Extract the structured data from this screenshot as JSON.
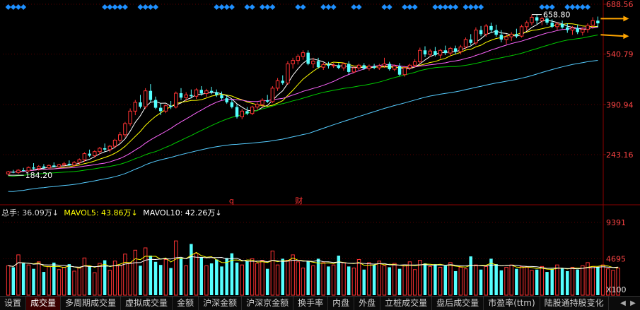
{
  "chart_data": {
    "type": "candlestick",
    "price_axis": {
      "ticks": [
        "688.56",
        "540.79",
        "390.94",
        "243.16"
      ],
      "ylim": [
        105,
        688.56
      ]
    },
    "annotations": {
      "high_label": "658.80",
      "low_label": "184.20",
      "event_markers": [
        "q",
        "财"
      ]
    },
    "candles": [
      {
        "o": 186,
        "h": 195,
        "l": 182,
        "c": 192
      },
      {
        "o": 192,
        "h": 198,
        "l": 188,
        "c": 190
      },
      {
        "o": 190,
        "h": 200,
        "l": 186,
        "c": 197
      },
      {
        "o": 197,
        "h": 204,
        "l": 193,
        "c": 195
      },
      {
        "o": 195,
        "h": 208,
        "l": 192,
        "c": 205
      },
      {
        "o": 205,
        "h": 218,
        "l": 198,
        "c": 202
      },
      {
        "o": 202,
        "h": 212,
        "l": 196,
        "c": 208
      },
      {
        "o": 208,
        "h": 215,
        "l": 200,
        "c": 204
      },
      {
        "o": 204,
        "h": 214,
        "l": 200,
        "c": 211
      },
      {
        "o": 211,
        "h": 220,
        "l": 205,
        "c": 207
      },
      {
        "o": 207,
        "h": 216,
        "l": 203,
        "c": 213
      },
      {
        "o": 213,
        "h": 222,
        "l": 208,
        "c": 216
      },
      {
        "o": 216,
        "h": 226,
        "l": 210,
        "c": 212
      },
      {
        "o": 212,
        "h": 224,
        "l": 208,
        "c": 220
      },
      {
        "o": 220,
        "h": 232,
        "l": 214,
        "c": 228
      },
      {
        "o": 228,
        "h": 250,
        "l": 222,
        "c": 246
      },
      {
        "o": 246,
        "h": 258,
        "l": 236,
        "c": 240
      },
      {
        "o": 240,
        "h": 256,
        "l": 234,
        "c": 252
      },
      {
        "o": 252,
        "h": 266,
        "l": 244,
        "c": 262
      },
      {
        "o": 262,
        "h": 276,
        "l": 252,
        "c": 258
      },
      {
        "o": 258,
        "h": 272,
        "l": 250,
        "c": 268
      },
      {
        "o": 268,
        "h": 290,
        "l": 262,
        "c": 286
      },
      {
        "o": 286,
        "h": 310,
        "l": 278,
        "c": 302
      },
      {
        "o": 302,
        "h": 340,
        "l": 294,
        "c": 335
      },
      {
        "o": 335,
        "h": 380,
        "l": 328,
        "c": 372
      },
      {
        "o": 372,
        "h": 405,
        "l": 360,
        "c": 398
      },
      {
        "o": 398,
        "h": 420,
        "l": 380,
        "c": 385
      },
      {
        "o": 385,
        "h": 440,
        "l": 378,
        "c": 432
      },
      {
        "o": 432,
        "h": 452,
        "l": 398,
        "c": 405
      },
      {
        "o": 405,
        "h": 415,
        "l": 378,
        "c": 382
      },
      {
        "o": 382,
        "h": 395,
        "l": 360,
        "c": 372
      },
      {
        "o": 372,
        "h": 392,
        "l": 366,
        "c": 388
      },
      {
        "o": 388,
        "h": 402,
        "l": 378,
        "c": 384
      },
      {
        "o": 384,
        "h": 430,
        "l": 380,
        "c": 425
      },
      {
        "o": 425,
        "h": 440,
        "l": 405,
        "c": 412
      },
      {
        "o": 412,
        "h": 428,
        "l": 402,
        "c": 420
      },
      {
        "o": 420,
        "h": 436,
        "l": 410,
        "c": 416
      },
      {
        "o": 416,
        "h": 440,
        "l": 408,
        "c": 435
      },
      {
        "o": 435,
        "h": 446,
        "l": 418,
        "c": 424
      },
      {
        "o": 424,
        "h": 438,
        "l": 414,
        "c": 432
      },
      {
        "o": 432,
        "h": 444,
        "l": 422,
        "c": 428
      },
      {
        "o": 428,
        "h": 436,
        "l": 414,
        "c": 420
      },
      {
        "o": 420,
        "h": 430,
        "l": 405,
        "c": 410
      },
      {
        "o": 410,
        "h": 418,
        "l": 394,
        "c": 398
      },
      {
        "o": 398,
        "h": 406,
        "l": 380,
        "c": 384
      },
      {
        "o": 384,
        "h": 392,
        "l": 350,
        "c": 355
      },
      {
        "o": 355,
        "h": 378,
        "l": 348,
        "c": 372
      },
      {
        "o": 372,
        "h": 384,
        "l": 360,
        "c": 365
      },
      {
        "o": 365,
        "h": 388,
        "l": 360,
        "c": 384
      },
      {
        "o": 384,
        "h": 398,
        "l": 376,
        "c": 392
      },
      {
        "o": 392,
        "h": 410,
        "l": 384,
        "c": 404
      },
      {
        "o": 404,
        "h": 420,
        "l": 396,
        "c": 400
      },
      {
        "o": 400,
        "h": 446,
        "l": 396,
        "c": 440
      },
      {
        "o": 440,
        "h": 470,
        "l": 432,
        "c": 462
      },
      {
        "o": 462,
        "h": 478,
        "l": 450,
        "c": 455
      },
      {
        "o": 455,
        "h": 520,
        "l": 450,
        "c": 512
      },
      {
        "o": 512,
        "h": 530,
        "l": 498,
        "c": 522
      },
      {
        "o": 522,
        "h": 540,
        "l": 510,
        "c": 534
      },
      {
        "o": 534,
        "h": 552,
        "l": 524,
        "c": 545
      },
      {
        "o": 545,
        "h": 552,
        "l": 508,
        "c": 512
      },
      {
        "o": 512,
        "h": 530,
        "l": 500,
        "c": 520
      },
      {
        "o": 520,
        "h": 530,
        "l": 498,
        "c": 502
      },
      {
        "o": 502,
        "h": 516,
        "l": 494,
        "c": 510
      },
      {
        "o": 510,
        "h": 518,
        "l": 498,
        "c": 506
      },
      {
        "o": 506,
        "h": 514,
        "l": 500,
        "c": 508
      },
      {
        "o": 508,
        "h": 514,
        "l": 496,
        "c": 500
      },
      {
        "o": 500,
        "h": 516,
        "l": 492,
        "c": 512
      },
      {
        "o": 512,
        "h": 520,
        "l": 482,
        "c": 488
      },
      {
        "o": 488,
        "h": 506,
        "l": 484,
        "c": 500
      },
      {
        "o": 500,
        "h": 512,
        "l": 494,
        "c": 508
      },
      {
        "o": 508,
        "h": 514,
        "l": 494,
        "c": 498
      },
      {
        "o": 498,
        "h": 510,
        "l": 492,
        "c": 505
      },
      {
        "o": 505,
        "h": 512,
        "l": 496,
        "c": 500
      },
      {
        "o": 500,
        "h": 512,
        "l": 494,
        "c": 506
      },
      {
        "o": 506,
        "h": 530,
        "l": 500,
        "c": 512
      },
      {
        "o": 512,
        "h": 518,
        "l": 492,
        "c": 496
      },
      {
        "o": 496,
        "h": 510,
        "l": 490,
        "c": 505
      },
      {
        "o": 505,
        "h": 514,
        "l": 476,
        "c": 480
      },
      {
        "o": 480,
        "h": 506,
        "l": 474,
        "c": 500
      },
      {
        "o": 500,
        "h": 512,
        "l": 494,
        "c": 508
      },
      {
        "o": 508,
        "h": 526,
        "l": 502,
        "c": 518
      },
      {
        "o": 518,
        "h": 560,
        "l": 512,
        "c": 552
      },
      {
        "o": 552,
        "h": 564,
        "l": 532,
        "c": 540
      },
      {
        "o": 540,
        "h": 556,
        "l": 532,
        "c": 550
      },
      {
        "o": 550,
        "h": 562,
        "l": 534,
        "c": 538
      },
      {
        "o": 538,
        "h": 556,
        "l": 528,
        "c": 552
      },
      {
        "o": 552,
        "h": 566,
        "l": 538,
        "c": 544
      },
      {
        "o": 544,
        "h": 562,
        "l": 536,
        "c": 558
      },
      {
        "o": 558,
        "h": 566,
        "l": 540,
        "c": 548
      },
      {
        "o": 548,
        "h": 568,
        "l": 540,
        "c": 562
      },
      {
        "o": 562,
        "h": 590,
        "l": 556,
        "c": 584
      },
      {
        "o": 584,
        "h": 600,
        "l": 568,
        "c": 574
      },
      {
        "o": 574,
        "h": 620,
        "l": 568,
        "c": 612
      },
      {
        "o": 612,
        "h": 624,
        "l": 594,
        "c": 600
      },
      {
        "o": 600,
        "h": 630,
        "l": 592,
        "c": 624
      },
      {
        "o": 624,
        "h": 634,
        "l": 604,
        "c": 612
      },
      {
        "o": 612,
        "h": 628,
        "l": 592,
        "c": 598
      },
      {
        "o": 598,
        "h": 612,
        "l": 576,
        "c": 584
      },
      {
        "o": 584,
        "h": 600,
        "l": 570,
        "c": 592
      },
      {
        "o": 592,
        "h": 606,
        "l": 580,
        "c": 600
      },
      {
        "o": 600,
        "h": 616,
        "l": 588,
        "c": 594
      },
      {
        "o": 594,
        "h": 628,
        "l": 590,
        "c": 622
      },
      {
        "o": 622,
        "h": 640,
        "l": 610,
        "c": 634
      },
      {
        "o": 634,
        "h": 658,
        "l": 626,
        "c": 650
      },
      {
        "o": 650,
        "h": 658,
        "l": 630,
        "c": 640
      },
      {
        "o": 640,
        "h": 652,
        "l": 626,
        "c": 646
      },
      {
        "o": 646,
        "h": 654,
        "l": 628,
        "c": 634
      },
      {
        "o": 634,
        "h": 644,
        "l": 618,
        "c": 622
      },
      {
        "o": 622,
        "h": 636,
        "l": 612,
        "c": 630
      },
      {
        "o": 630,
        "h": 640,
        "l": 616,
        "c": 620
      },
      {
        "o": 620,
        "h": 632,
        "l": 604,
        "c": 612
      },
      {
        "o": 612,
        "h": 624,
        "l": 598,
        "c": 618
      },
      {
        "o": 618,
        "h": 628,
        "l": 600,
        "c": 606
      },
      {
        "o": 606,
        "h": 620,
        "l": 596,
        "c": 614
      },
      {
        "o": 614,
        "h": 632,
        "l": 604,
        "c": 626
      },
      {
        "o": 626,
        "h": 650,
        "l": 616,
        "c": 640
      },
      {
        "o": 640,
        "h": 652,
        "l": 620,
        "c": 632
      }
    ],
    "volume_axis": {
      "ticks": [
        "9391",
        "4695",
        "X100"
      ],
      "ylim": [
        0,
        10200
      ]
    },
    "volume": [
      3800,
      3600,
      5200,
      4100,
      3900,
      3400,
      4300,
      3000,
      3700,
      4200,
      3300,
      3600,
      4000,
      3100,
      3500,
      4800,
      3700,
      2900,
      4100,
      4500,
      3200,
      4400,
      3800,
      5300,
      4200,
      5800,
      3800,
      6100,
      5100,
      4300,
      3900,
      4600,
      3500,
      7000,
      4800,
      3800,
      6600,
      5400,
      4900,
      3800,
      4100,
      4600,
      3700,
      4800,
      5400,
      4200,
      3900,
      4400,
      4700,
      4100,
      4500,
      3400,
      5700,
      3900,
      4700,
      4500,
      5200,
      4300,
      3500,
      4400,
      3800,
      4700,
      4200,
      3700,
      3900,
      5100,
      4200,
      3700,
      3500,
      4600,
      3300,
      4200,
      3900,
      4400,
      3800,
      3600,
      4100,
      3400,
      3900,
      4300,
      3300,
      4500,
      4100,
      3700,
      4000,
      3600,
      3800,
      4200,
      3100,
      3600,
      3400,
      5000,
      3900,
      3300,
      3700,
      4700,
      4000,
      3200,
      3600,
      3900,
      3400,
      3700,
      3600,
      3200,
      3300,
      3700,
      3000,
      3400,
      3900,
      3500,
      3100,
      3600,
      3300,
      3800,
      4200,
      3700,
      3600,
      3900,
      3400,
      3200,
      3500
    ],
    "volume_legend": {
      "total": "总手: 36.09万↓",
      "ma5": "MAVOL5: 43.86万↓",
      "ma10": "MAVOL10: 42.26万↓"
    },
    "ma_colors": {
      "ma5": "#ffffff",
      "ma10": "#ffff00",
      "ma20": "#ff66ff",
      "ma30": "#00cc00",
      "ma60": "#55ccff"
    },
    "up_color": "#ff3333",
    "down_color": "#54ffff"
  },
  "tabs": [
    "设置",
    "成交量",
    "多周期成交量",
    "虚拟成交量",
    "金额",
    "沪深金额",
    "沪深京金额",
    "换手率",
    "内盘",
    "外盘",
    "立桩成交量",
    "盘后成交量",
    "市盈率(ttm)",
    "陆股通持股变化"
  ],
  "active_tab_index": 1,
  "colors": {
    "bg": "#000000",
    "axis": "#8b0000",
    "grid": "#5a0000",
    "tick_text": "#ff4444"
  }
}
